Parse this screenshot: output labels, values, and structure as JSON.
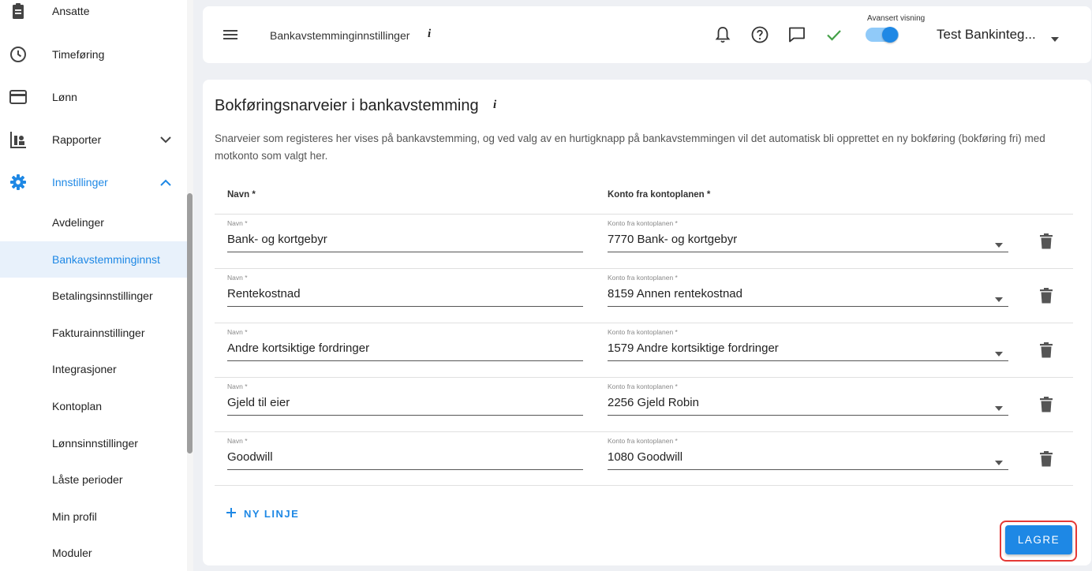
{
  "sidebar": {
    "items": [
      {
        "label": "Ansatte",
        "icon": "badge-icon"
      },
      {
        "label": "Timeføring",
        "icon": "clock-icon"
      },
      {
        "label": "Lønn",
        "icon": "credit-card-icon"
      },
      {
        "label": "Rapporter",
        "icon": "report-icon"
      },
      {
        "label": "Innstillinger",
        "icon": "gear-icon"
      }
    ],
    "subitems": [
      "Avdelinger",
      "Bankavstemminginnst",
      "Betalingsinnstillinger",
      "Fakturainnstillinger",
      "Integrasjoner",
      "Kontoplan",
      "Lønnsinnstillinger",
      "Låste perioder",
      "Min profil",
      "Moduler"
    ],
    "selected_subitem": "Bankavstemminginnst",
    "accent_color": "#1e88e5"
  },
  "header": {
    "title": "Bankavstemminginnstillinger",
    "info": "i",
    "toggle_label": "Avansert visning",
    "toggle_on": true,
    "company": "Test Bankinteg..."
  },
  "main": {
    "title": "Bokføringsnarveier i bankavstemming",
    "info": "i",
    "description": "Snarveier som registeres her vises på bankavstemming, og ved valg av en hurtigknapp på bankavstemmingen vil det automatisk bli opprettet en ny bokføring (bokføring fri) med motkonto som valgt her.",
    "col_name": "Navn *",
    "col_account": "Konto fra kontoplanen *",
    "field_label_name": "Navn *",
    "field_label_account": "Konto fra kontoplanen *",
    "rows": [
      {
        "name": "Bank- og kortgebyr",
        "account": "7770 Bank- og kortgebyr"
      },
      {
        "name": "Rentekostnad",
        "account": "8159 Annen rentekostnad"
      },
      {
        "name": "Andre kortsiktige fordringer",
        "account": "1579 Andre kortsiktige fordringer"
      },
      {
        "name": "Gjeld til eier",
        "account": "2256 Gjeld Robin"
      },
      {
        "name": "Goodwill",
        "account": "1080 Goodwill"
      }
    ],
    "new_line_label": "NY LINJE",
    "save_label": "LAGRE"
  }
}
